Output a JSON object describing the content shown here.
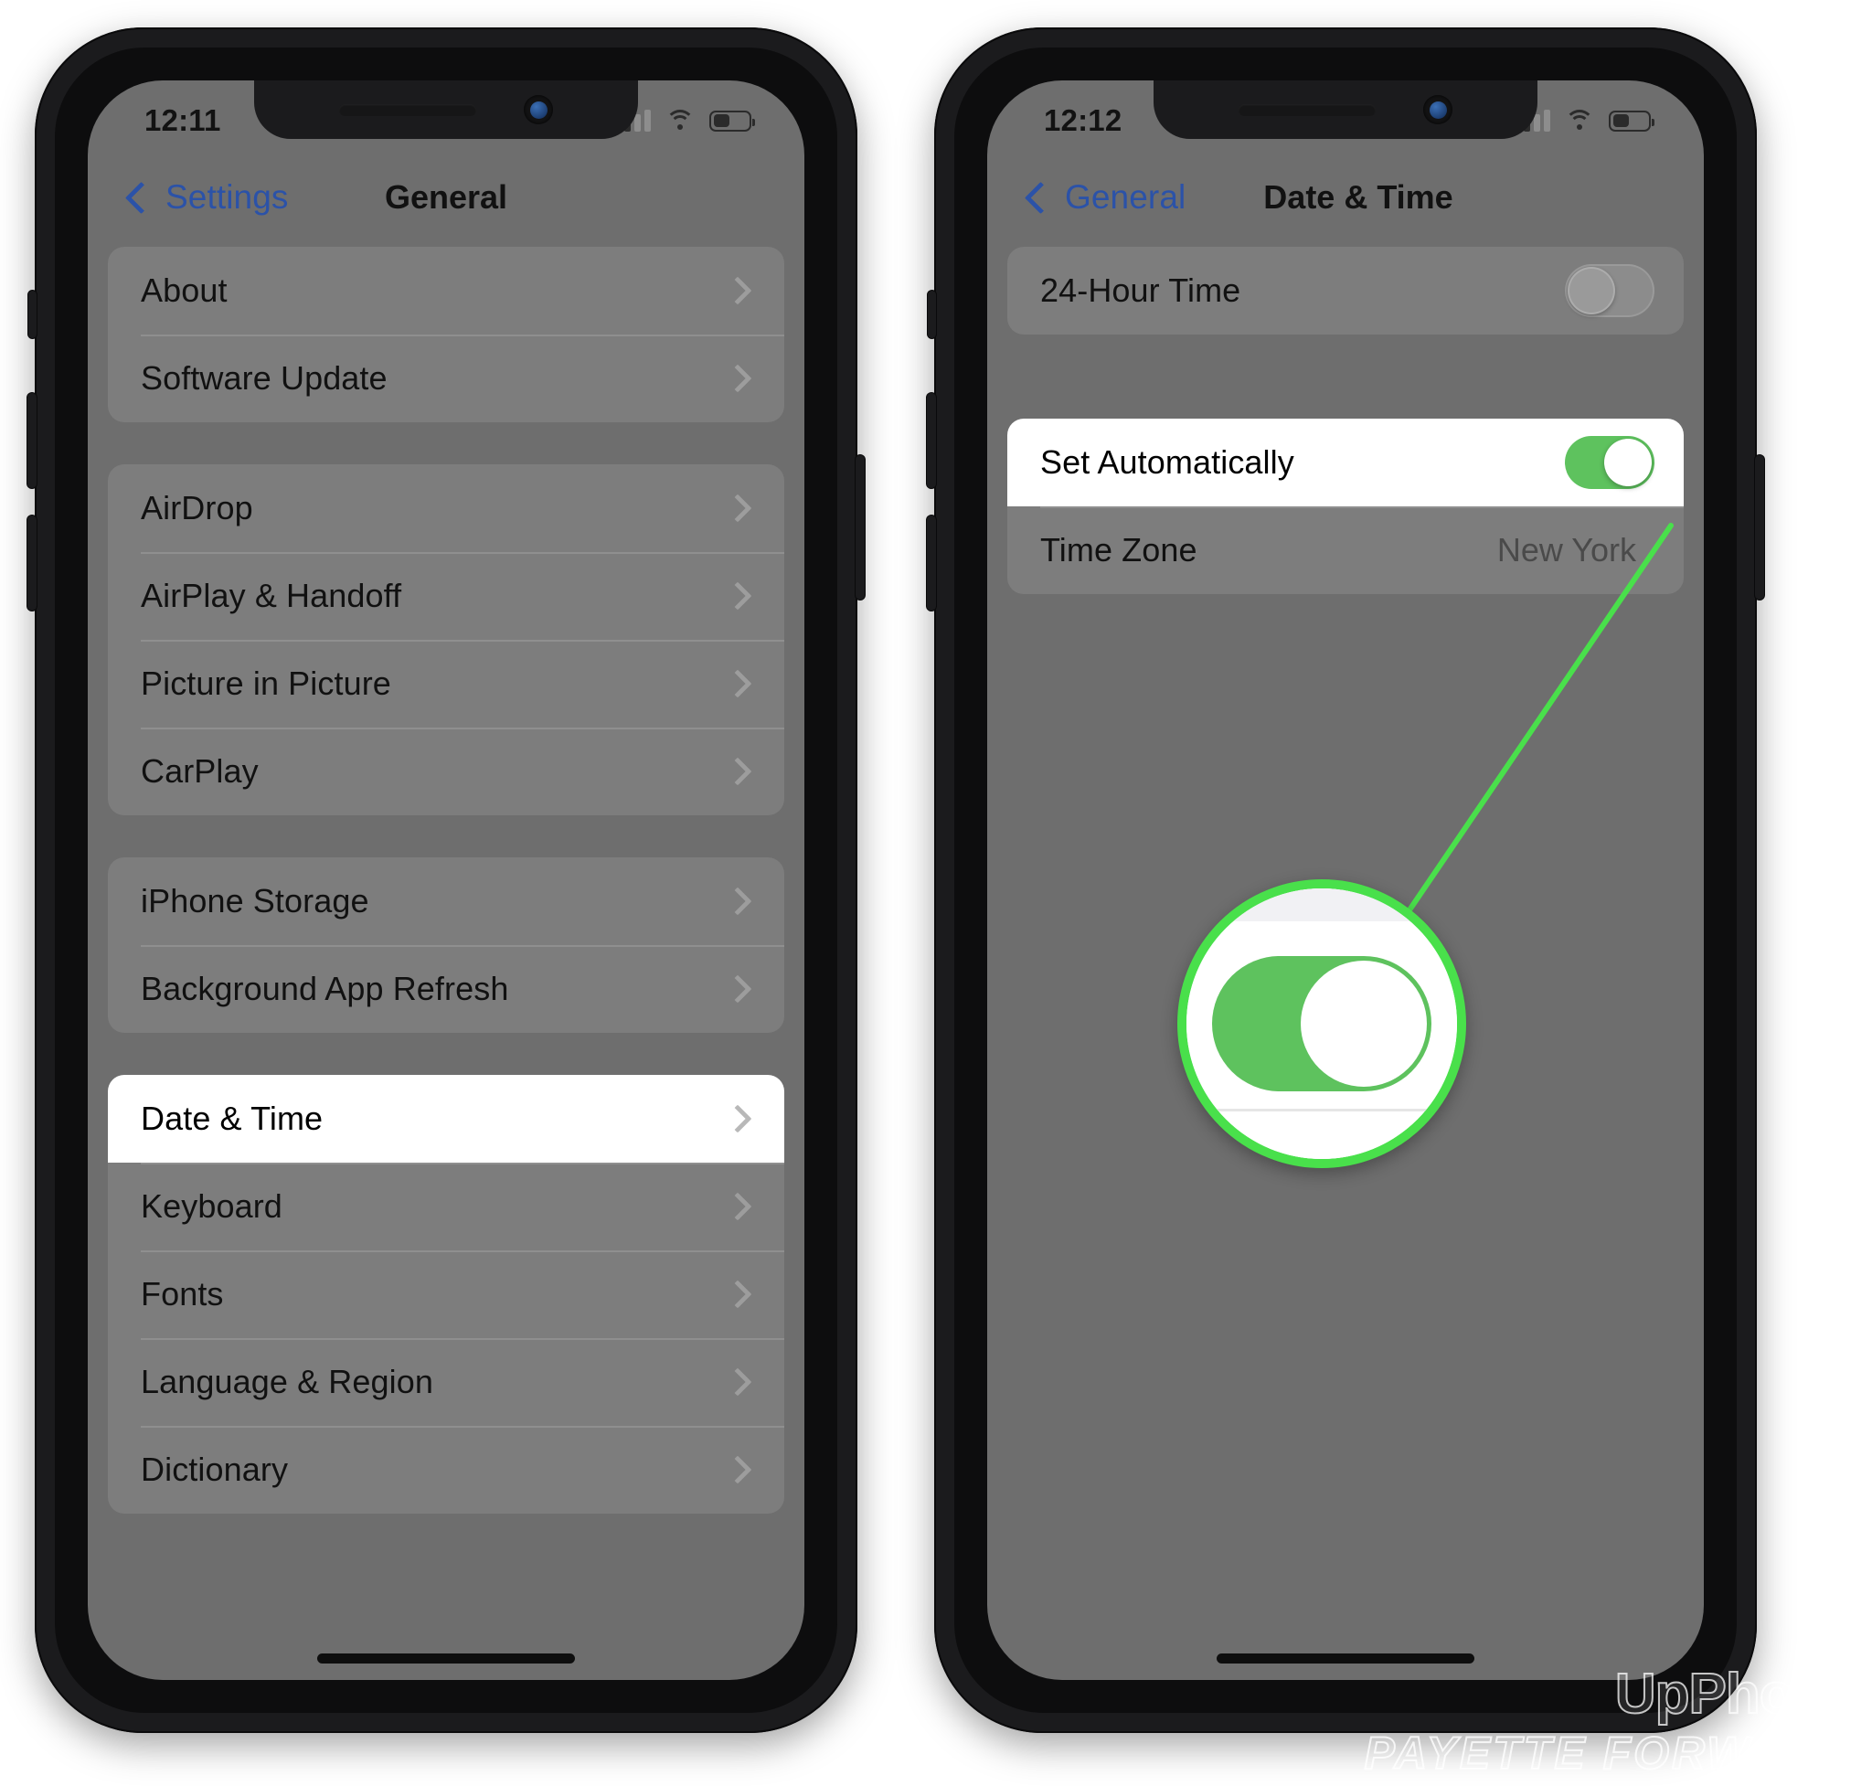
{
  "colors": {
    "accent_blue": "#2b52a8",
    "toggle_on_green": "#5ec25e",
    "callout_green": "#49e04b",
    "screen_bg": "#6e6e6e",
    "group_bg": "#7d7d7d",
    "highlight_bg": "#ffffff"
  },
  "left_phone": {
    "status": {
      "time": "12:11",
      "signal_icon": "cellular-signal-icon",
      "signal_bars_filled": 2,
      "signal_bars_total": 4,
      "wifi_icon": "wifi-icon",
      "battery_icon": "battery-icon",
      "battery_level_percent": 45
    },
    "nav": {
      "back_icon": "chevron-left-icon",
      "back_label": "Settings",
      "title": "General"
    },
    "groups": [
      {
        "name": "info-group",
        "rows": [
          {
            "label": "About",
            "accessory": "chevron-right-icon"
          },
          {
            "label": "Software Update",
            "accessory": "chevron-right-icon"
          }
        ]
      },
      {
        "name": "connectivity-group",
        "rows": [
          {
            "label": "AirDrop",
            "accessory": "chevron-right-icon"
          },
          {
            "label": "AirPlay & Handoff",
            "accessory": "chevron-right-icon"
          },
          {
            "label": "Picture in Picture",
            "accessory": "chevron-right-icon"
          },
          {
            "label": "CarPlay",
            "accessory": "chevron-right-icon"
          }
        ]
      },
      {
        "name": "storage-group",
        "rows": [
          {
            "label": "iPhone Storage",
            "accessory": "chevron-right-icon"
          },
          {
            "label": "Background App Refresh",
            "accessory": "chevron-right-icon"
          }
        ]
      },
      {
        "name": "system-group",
        "rows": [
          {
            "label": "Date & Time",
            "accessory": "chevron-right-icon",
            "highlighted": true
          },
          {
            "label": "Keyboard",
            "accessory": "chevron-right-icon"
          },
          {
            "label": "Fonts",
            "accessory": "chevron-right-icon"
          },
          {
            "label": "Language & Region",
            "accessory": "chevron-right-icon"
          },
          {
            "label": "Dictionary",
            "accessory": "chevron-right-icon"
          }
        ]
      }
    ]
  },
  "right_phone": {
    "status": {
      "time": "12:12",
      "signal_icon": "cellular-signal-icon",
      "signal_bars_filled": 2,
      "signal_bars_total": 4,
      "wifi_icon": "wifi-icon",
      "battery_icon": "battery-icon",
      "battery_level_percent": 45
    },
    "nav": {
      "back_icon": "chevron-left-icon",
      "back_label": "General",
      "title": "Date & Time"
    },
    "rows": {
      "hour24_label": "24-Hour Time",
      "hour24_state": "off",
      "set_automatically_label": "Set Automatically",
      "set_automatically_state": "on",
      "time_zone_label": "Time Zone",
      "time_zone_value": "New York"
    },
    "callout": {
      "type": "magnifier-circle",
      "target": "set-automatically-toggle",
      "toggle_state": "on"
    }
  },
  "watermark": {
    "brand": "UpPhone",
    "publisher": "PAYETTE FORWARD"
  }
}
